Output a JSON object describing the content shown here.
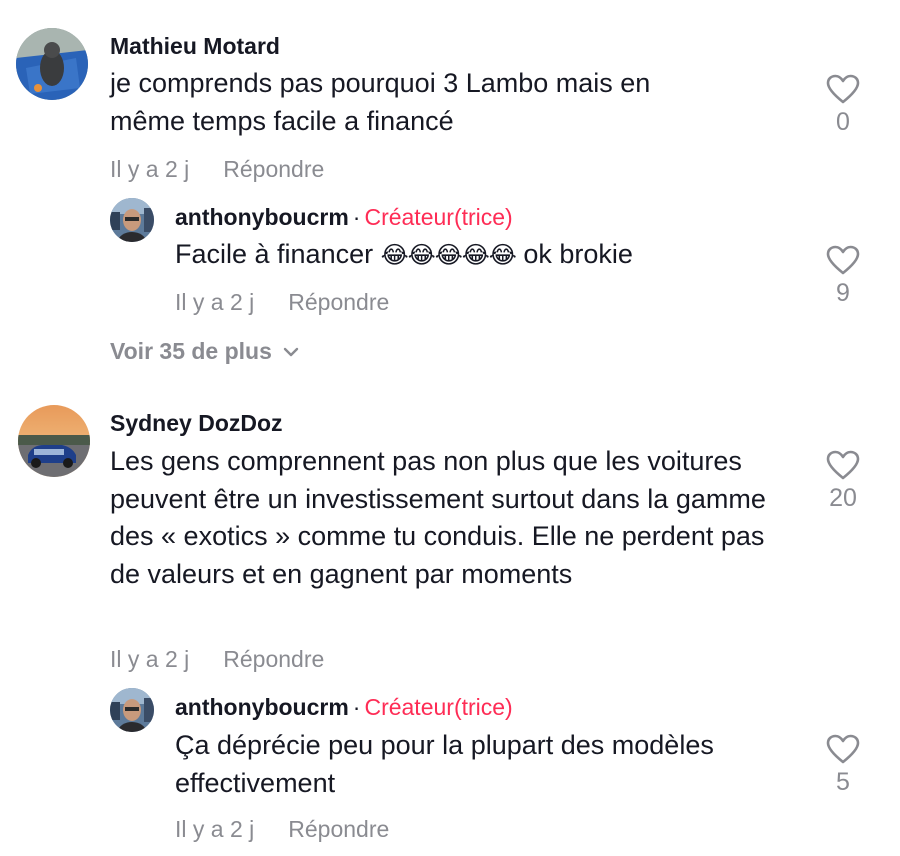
{
  "comments": [
    {
      "username": "Mathieu Motard",
      "text": "je comprends pas pourquoi 3 Lambo mais en même temps facile a financé",
      "time": "Il y a 2 j",
      "reply_label": "Répondre",
      "likes": "0",
      "replies": [
        {
          "username": "anthonyboucrm",
          "separator": "·",
          "badge": "Créateur(trice)",
          "text_before": "Facile à financer",
          "emojis": "😂😂😂😂😂",
          "text_after": "ok brokie",
          "time": "Il y a 2 j",
          "reply_label": "Répondre",
          "likes": "9"
        }
      ],
      "more_label": "Voir 35 de plus"
    },
    {
      "username": "Sydney DozDoz",
      "text": "Les gens comprennent pas non plus que les voitures peuvent être un investissement surtout dans la gamme des « exotics » comme tu conduis. Elle ne perdent pas de valeurs et en gagnent par moments",
      "time": "Il y a 2 j",
      "reply_label": "Répondre",
      "likes": "20",
      "replies": [
        {
          "username": "anthonyboucrm",
          "separator": "·",
          "badge": "Créateur(trice)",
          "text": "Ça déprécie peu pour la plupart des modèles effectivement",
          "time": "Il y a 2 j",
          "reply_label": "Répondre",
          "likes": "5"
        }
      ]
    }
  ],
  "colors": {
    "creator_badge": "#fe2c55",
    "meta_text": "#8a8b91",
    "primary_text": "#161823"
  },
  "icons": {
    "like": "heart-outline-icon",
    "expand": "chevron-down-icon"
  }
}
